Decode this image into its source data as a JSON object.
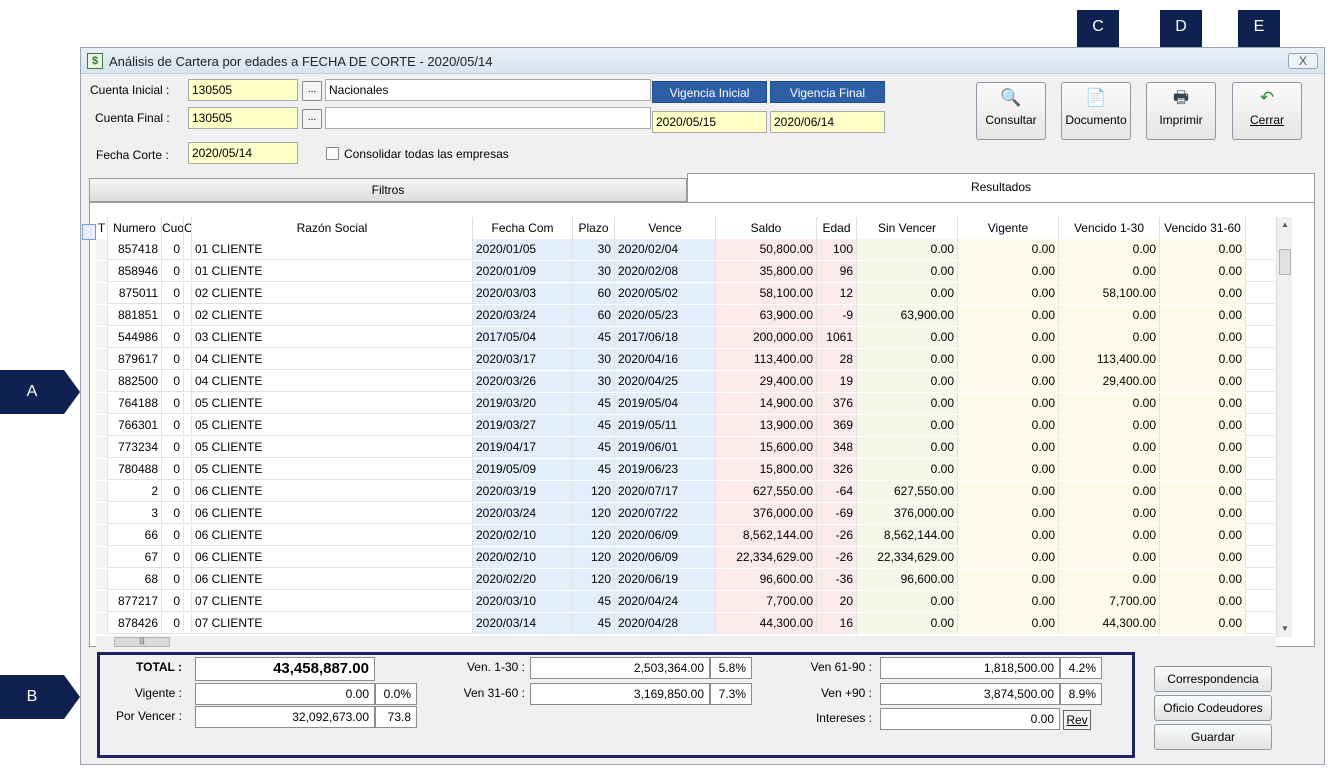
{
  "window": {
    "title": "Análisis de Cartera por edades a FECHA DE CORTE - 2020/05/14",
    "close_label": "X"
  },
  "form": {
    "cuenta_inicial_label": "Cuenta Inicial :",
    "cuenta_inicial_value": "130505",
    "cuenta_inicial_name": "Nacionales",
    "cuenta_final_label": "Cuenta Final :",
    "cuenta_final_value": "130505",
    "cuenta_final_name": "",
    "fecha_corte_label": "Fecha Corte :",
    "fecha_corte_value": "2020/05/14",
    "ellipsis": "...",
    "consolidar_label": "Consolidar todas las empresas",
    "vigencia_inicial_label": "Vigencia Inicial",
    "vigencia_inicial_value": "2020/05/15",
    "vigencia_final_label": "Vigencia Final",
    "vigencia_final_value": "2020/06/14"
  },
  "toolbar": {
    "consultar": "Consultar",
    "documento": "Documento",
    "imprimir": "Imprimir",
    "cerrar": "Cerrar"
  },
  "tabs": {
    "filtros": "Filtros",
    "resultados": "Resultados"
  },
  "grid": {
    "columns": [
      "T",
      "Numero",
      "Cuo",
      "C",
      "Razón Social",
      "Fecha Com",
      "Plazo",
      "Vence",
      "Saldo",
      "Edad",
      "Sin Vencer",
      "Vigente",
      "Vencido 1-30",
      "Vencido 31-60"
    ],
    "rows": [
      {
        "numero": "857418",
        "cuota": "0",
        "razon": "01 CLIENTE",
        "fecha": "2020/01/05",
        "plazo": "30",
        "vence": "2020/02/04",
        "saldo": "50,800.00",
        "edad": "100",
        "sin_vencer": "0.00",
        "vigente": "0.00",
        "v1_30": "0.00",
        "v31_60": "0.00"
      },
      {
        "numero": "858946",
        "cuota": "0",
        "razon": "01 CLIENTE",
        "fecha": "2020/01/09",
        "plazo": "30",
        "vence": "2020/02/08",
        "saldo": "35,800.00",
        "edad": "96",
        "sin_vencer": "0.00",
        "vigente": "0.00",
        "v1_30": "0.00",
        "v31_60": "0.00"
      },
      {
        "numero": "875011",
        "cuota": "0",
        "razon": "02 CLIENTE",
        "fecha": "2020/03/03",
        "plazo": "60",
        "vence": "2020/05/02",
        "saldo": "58,100.00",
        "edad": "12",
        "sin_vencer": "0.00",
        "vigente": "0.00",
        "v1_30": "58,100.00",
        "v31_60": "0.00"
      },
      {
        "numero": "881851",
        "cuota": "0",
        "razon": "02 CLIENTE",
        "fecha": "2020/03/24",
        "plazo": "60",
        "vence": "2020/05/23",
        "saldo": "63,900.00",
        "edad": "-9",
        "sin_vencer": "63,900.00",
        "vigente": "0.00",
        "v1_30": "0.00",
        "v31_60": "0.00"
      },
      {
        "numero": "544986",
        "cuota": "0",
        "razon": "03 CLIENTE",
        "fecha": "2017/05/04",
        "plazo": "45",
        "vence": "2017/06/18",
        "saldo": "200,000.00",
        "edad": "1061",
        "sin_vencer": "0.00",
        "vigente": "0.00",
        "v1_30": "0.00",
        "v31_60": "0.00"
      },
      {
        "numero": "879617",
        "cuota": "0",
        "razon": "04 CLIENTE",
        "fecha": "2020/03/17",
        "plazo": "30",
        "vence": "2020/04/16",
        "saldo": "113,400.00",
        "edad": "28",
        "sin_vencer": "0.00",
        "vigente": "0.00",
        "v1_30": "113,400.00",
        "v31_60": "0.00"
      },
      {
        "numero": "882500",
        "cuota": "0",
        "razon": "04 CLIENTE",
        "fecha": "2020/03/26",
        "plazo": "30",
        "vence": "2020/04/25",
        "saldo": "29,400.00",
        "edad": "19",
        "sin_vencer": "0.00",
        "vigente": "0.00",
        "v1_30": "29,400.00",
        "v31_60": "0.00"
      },
      {
        "numero": "764188",
        "cuota": "0",
        "razon": "05 CLIENTE",
        "fecha": "2019/03/20",
        "plazo": "45",
        "vence": "2019/05/04",
        "saldo": "14,900.00",
        "edad": "376",
        "sin_vencer": "0.00",
        "vigente": "0.00",
        "v1_30": "0.00",
        "v31_60": "0.00"
      },
      {
        "numero": "766301",
        "cuota": "0",
        "razon": "05 CLIENTE",
        "fecha": "2019/03/27",
        "plazo": "45",
        "vence": "2019/05/11",
        "saldo": "13,900.00",
        "edad": "369",
        "sin_vencer": "0.00",
        "vigente": "0.00",
        "v1_30": "0.00",
        "v31_60": "0.00"
      },
      {
        "numero": "773234",
        "cuota": "0",
        "razon": "05 CLIENTE",
        "fecha": "2019/04/17",
        "plazo": "45",
        "vence": "2019/06/01",
        "saldo": "15,600.00",
        "edad": "348",
        "sin_vencer": "0.00",
        "vigente": "0.00",
        "v1_30": "0.00",
        "v31_60": "0.00"
      },
      {
        "numero": "780488",
        "cuota": "0",
        "razon": "05 CLIENTE",
        "fecha": "2019/05/09",
        "plazo": "45",
        "vence": "2019/06/23",
        "saldo": "15,800.00",
        "edad": "326",
        "sin_vencer": "0.00",
        "vigente": "0.00",
        "v1_30": "0.00",
        "v31_60": "0.00"
      },
      {
        "numero": "2",
        "cuota": "0",
        "razon": "06 CLIENTE",
        "fecha": "2020/03/19",
        "plazo": "120",
        "vence": "2020/07/17",
        "saldo": "627,550.00",
        "edad": "-64",
        "sin_vencer": "627,550.00",
        "vigente": "0.00",
        "v1_30": "0.00",
        "v31_60": "0.00"
      },
      {
        "numero": "3",
        "cuota": "0",
        "razon": "06 CLIENTE",
        "fecha": "2020/03/24",
        "plazo": "120",
        "vence": "2020/07/22",
        "saldo": "376,000.00",
        "edad": "-69",
        "sin_vencer": "376,000.00",
        "vigente": "0.00",
        "v1_30": "0.00",
        "v31_60": "0.00"
      },
      {
        "numero": "66",
        "cuota": "0",
        "razon": "06 CLIENTE",
        "fecha": "2020/02/10",
        "plazo": "120",
        "vence": "2020/06/09",
        "saldo": "8,562,144.00",
        "edad": "-26",
        "sin_vencer": "8,562,144.00",
        "vigente": "0.00",
        "v1_30": "0.00",
        "v31_60": "0.00"
      },
      {
        "numero": "67",
        "cuota": "0",
        "razon": "06 CLIENTE",
        "fecha": "2020/02/10",
        "plazo": "120",
        "vence": "2020/06/09",
        "saldo": "22,334,629.00",
        "edad": "-26",
        "sin_vencer": "22,334,629.00",
        "vigente": "0.00",
        "v1_30": "0.00",
        "v31_60": "0.00"
      },
      {
        "numero": "68",
        "cuota": "0",
        "razon": "06 CLIENTE",
        "fecha": "2020/02/20",
        "plazo": "120",
        "vence": "2020/06/19",
        "saldo": "96,600.00",
        "edad": "-36",
        "sin_vencer": "96,600.00",
        "vigente": "0.00",
        "v1_30": "0.00",
        "v31_60": "0.00"
      },
      {
        "numero": "877217",
        "cuota": "0",
        "razon": "07 CLIENTE",
        "fecha": "2020/03/10",
        "plazo": "45",
        "vence": "2020/04/24",
        "saldo": "7,700.00",
        "edad": "20",
        "sin_vencer": "0.00",
        "vigente": "0.00",
        "v1_30": "7,700.00",
        "v31_60": "0.00"
      },
      {
        "numero": "878426",
        "cuota": "0",
        "razon": "07 CLIENTE",
        "fecha": "2020/03/14",
        "plazo": "45",
        "vence": "2020/04/28",
        "saldo": "44,300.00",
        "edad": "16",
        "sin_vencer": "0.00",
        "vigente": "0.00",
        "v1_30": "44,300.00",
        "v31_60": "0.00"
      }
    ]
  },
  "totals": {
    "total_label": "TOTAL :",
    "total_value": "43,458,887.00",
    "vigente_label": "Vigente :",
    "vigente_value": "0.00",
    "vigente_pct": "0.0%",
    "por_vencer_label": "Por Vencer :",
    "por_vencer_value": "32,092,673.00",
    "por_vencer_pct": "73.8",
    "ven_1_30_label": "Ven. 1-30 :",
    "ven_1_30_value": "2,503,364.00",
    "ven_1_30_pct": "5.8%",
    "ven_31_60_label": "Ven 31-60 :",
    "ven_31_60_value": "3,169,850.00",
    "ven_31_60_pct": "7.3%",
    "ven_61_90_label": "Ven 61-90 :",
    "ven_61_90_value": "1,818,500.00",
    "ven_61_90_pct": "4.2%",
    "ven_90_label": "Ven +90 :",
    "ven_90_value": "3,874,500.00",
    "ven_90_pct": "8.9%",
    "intereses_label": "Intereses :",
    "intereses_value": "0.00",
    "rev_label": "Rev"
  },
  "side_buttons": {
    "correspondencia": "Correspondencia",
    "oficio": "Oficio Codeudores",
    "guardar": "Guardar"
  },
  "callouts": {
    "a": "A",
    "b": "B",
    "c": "C",
    "d": "D",
    "e": "E"
  },
  "colors": {
    "callout": "#0f2150",
    "field_yellow": "#ffffc8",
    "vigencia_header": "#2e5fa6"
  }
}
